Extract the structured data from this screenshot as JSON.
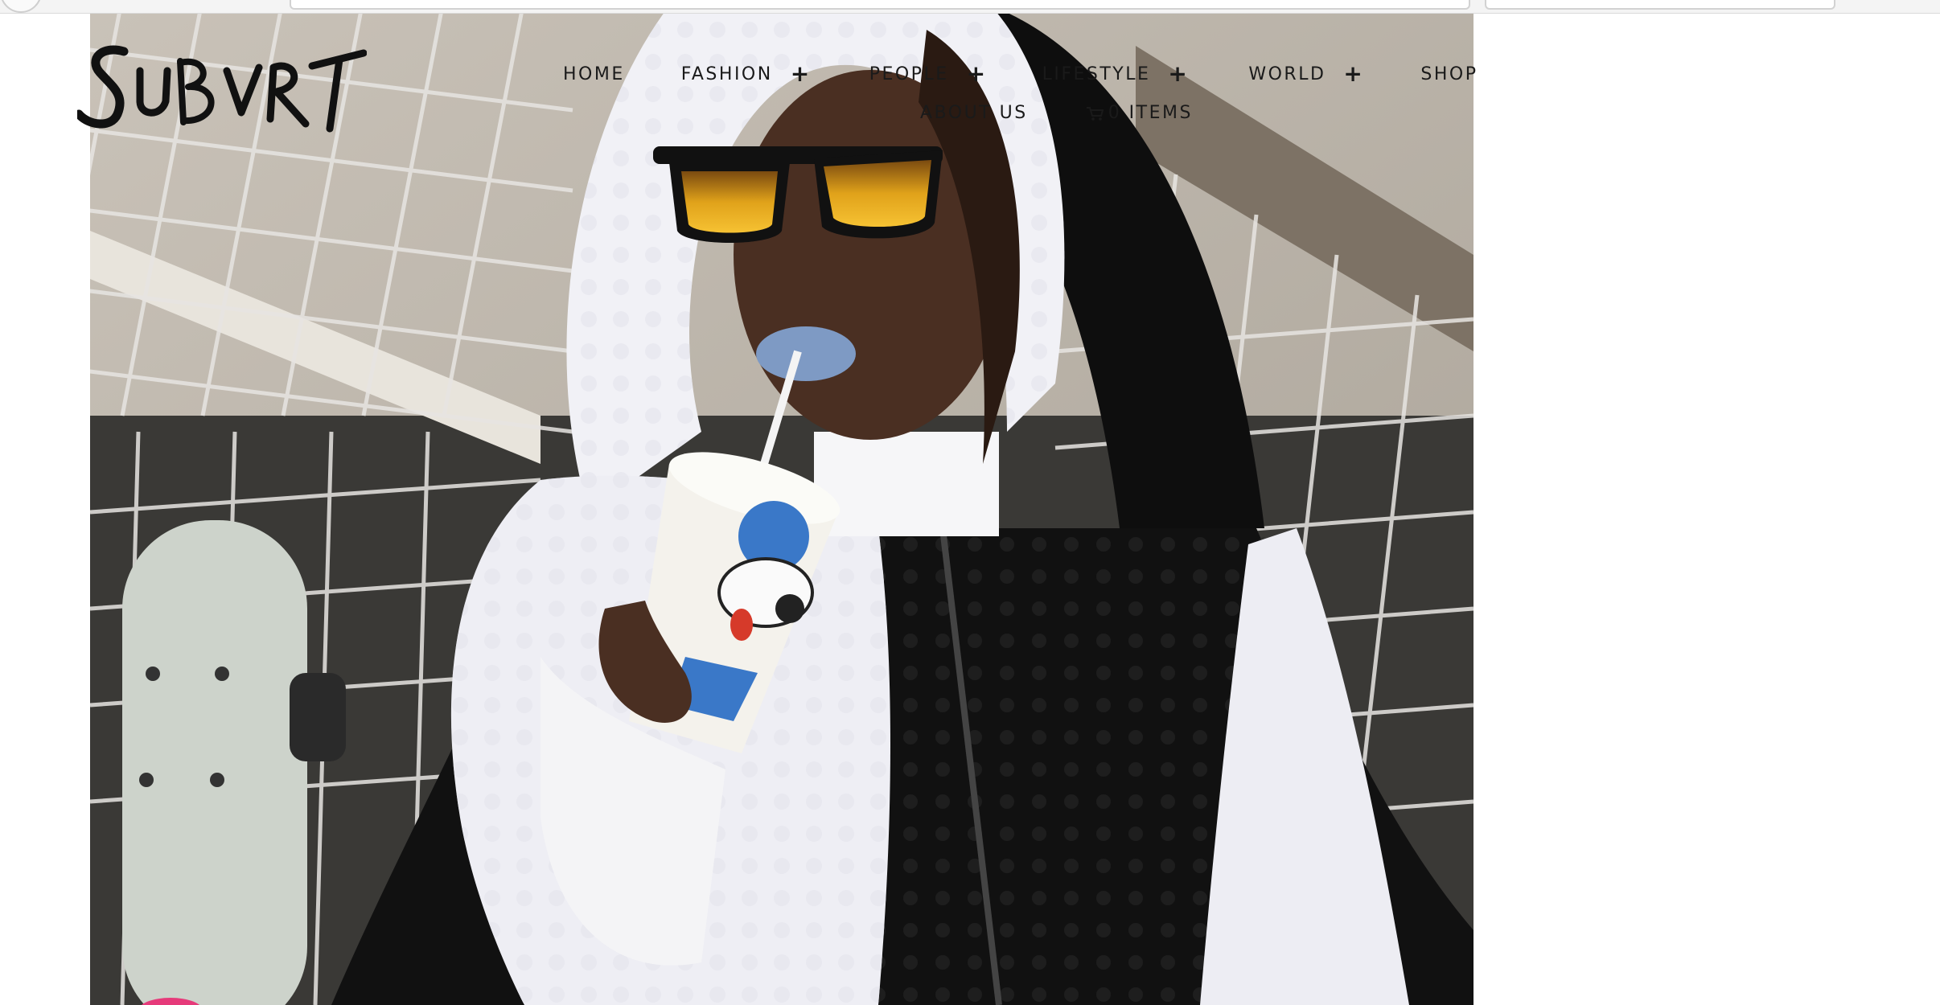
{
  "brand": {
    "logo_text": "SUBVRT"
  },
  "nav": {
    "items": [
      {
        "label": "HOME",
        "has_submenu": false
      },
      {
        "label": "FASHION",
        "has_submenu": true
      },
      {
        "label": "PEOPLE",
        "has_submenu": true
      },
      {
        "label": "LIFESTYLE",
        "has_submenu": true
      },
      {
        "label": "WORLD",
        "has_submenu": true
      },
      {
        "label": "SHOP",
        "has_submenu": false
      }
    ],
    "about_label": "ABOUT US",
    "cart_label": "0 ITEMS",
    "submenu_symbol": "+",
    "cart_icon": "cart-icon"
  },
  "hero": {
    "image_icon": "hero-photo"
  },
  "colors": {
    "nav_text": "#1a1a1a",
    "page_background": "#ffffff"
  }
}
